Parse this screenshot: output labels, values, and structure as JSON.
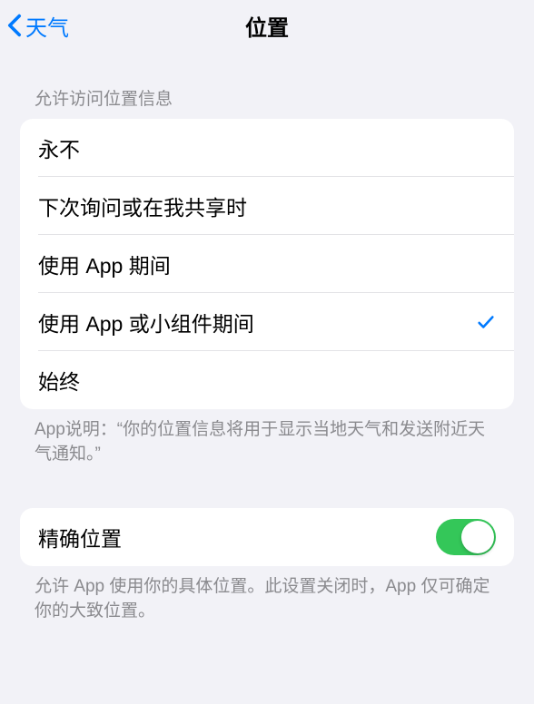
{
  "nav": {
    "back_label": "天气",
    "title": "位置"
  },
  "section1": {
    "header": "允许访问位置信息",
    "options": [
      {
        "label": "永不",
        "selected": false
      },
      {
        "label": "下次询问或在我共享时",
        "selected": false
      },
      {
        "label": "使用 App 期间",
        "selected": false
      },
      {
        "label": "使用 App 或小组件期间",
        "selected": true
      },
      {
        "label": "始终",
        "selected": false
      }
    ],
    "footer": "App说明：“你的位置信息将用于显示当地天气和发送附近天气通知。”"
  },
  "section2": {
    "precise_location": {
      "label": "精确位置",
      "value": true
    },
    "footer": "允许 App 使用你的具体位置。此设置关闭时，App 仅可确定你的大致位置。"
  }
}
